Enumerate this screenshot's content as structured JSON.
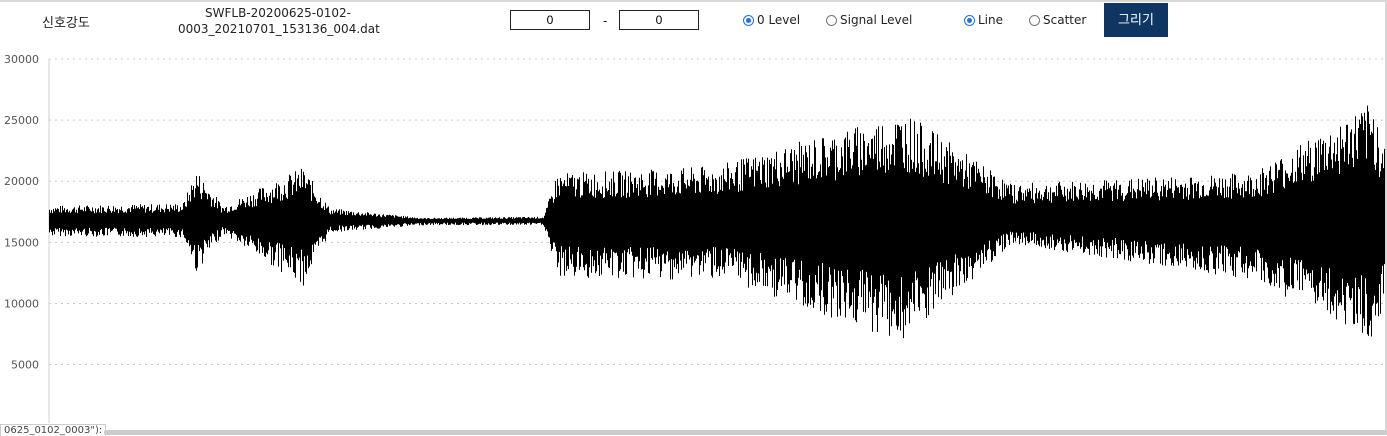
{
  "controls": {
    "signal_label": "신호강도",
    "filename": "SWFLB-20200625-0102-0003_20210701_153136_004.dat",
    "range_start": "0",
    "range_separator": "-",
    "range_end": "0",
    "level_options": [
      {
        "label": "0 Level",
        "selected": true
      },
      {
        "label": "Signal Level",
        "selected": false
      }
    ],
    "style_options": [
      {
        "label": "Line",
        "selected": true
      },
      {
        "label": "Scatter",
        "selected": false
      }
    ],
    "draw_button": "그리기",
    "accent_color": "#0f3563",
    "radio_color": "#1a73e8"
  },
  "tooltip_fragment": "0625_0102_0003\"):",
  "chart_data": {
    "type": "line",
    "xlabel": "",
    "ylabel": "",
    "ylim": [
      3000,
      30000
    ],
    "yticks": [
      5000,
      10000,
      15000,
      20000,
      25000,
      30000
    ],
    "grid": "horizontal dotted",
    "line_color": "#000000",
    "series": [
      {
        "values_summary": "dense oscillating signal with baseline about 16800; bursts peak near 26000 and dip near 6900",
        "envelope": [
          {
            "x": 0.0,
            "upper": 18000,
            "lower": 15500
          },
          {
            "x": 0.1,
            "upper": 18200,
            "lower": 15400
          },
          {
            "x": 0.11,
            "upper": 21000,
            "lower": 12500
          },
          {
            "x": 0.13,
            "upper": 18000,
            "lower": 15700
          },
          {
            "x": 0.19,
            "upper": 21200,
            "lower": 11400
          },
          {
            "x": 0.21,
            "upper": 17800,
            "lower": 15800
          },
          {
            "x": 0.28,
            "upper": 17000,
            "lower": 16400
          },
          {
            "x": 0.37,
            "upper": 17100,
            "lower": 16400
          },
          {
            "x": 0.38,
            "upper": 20700,
            "lower": 12100
          },
          {
            "x": 0.46,
            "upper": 21000,
            "lower": 11900
          },
          {
            "x": 0.5,
            "upper": 21300,
            "lower": 12100
          },
          {
            "x": 0.64,
            "upper": 25700,
            "lower": 6700
          },
          {
            "x": 0.72,
            "upper": 19800,
            "lower": 14900
          },
          {
            "x": 0.9,
            "upper": 20700,
            "lower": 11900
          },
          {
            "x": 0.99,
            "upper": 26500,
            "lower": 7100
          },
          {
            "x": 1.0,
            "upper": 23000,
            "lower": 9500
          }
        ]
      }
    ]
  }
}
